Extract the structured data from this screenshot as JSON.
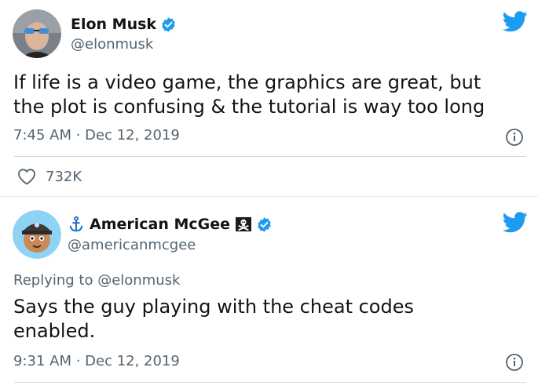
{
  "colors": {
    "twitter_blue": "#1d9bf0",
    "text_primary": "#0f1419",
    "text_secondary": "#536471",
    "divider": "#cfd9de"
  },
  "tweets": [
    {
      "author_name": "Elon Musk",
      "handle": "@elonmusk",
      "verified": true,
      "avatar_icon": "avatar-photo",
      "text_lines": [
        "If life is a video game, the graphics are great, but",
        "the plot is confusing & the tutorial is way too long"
      ],
      "timestamp": "7:45 AM · Dec 12, 2019",
      "likes": "732K"
    },
    {
      "author_name": "American McGee",
      "handle": "@americanmcgee",
      "verified": true,
      "avatar_icon": "avatar-cartoon-pirate",
      "name_prefix_icon": "anchor-icon",
      "name_suffix_icon": "pirate-flag-icon",
      "replying_to": "Replying to @elonmusk",
      "text_lines": [
        "Says the guy playing with the cheat codes",
        "enabled."
      ],
      "timestamp": "9:31 AM · Dec 12, 2019"
    }
  ]
}
